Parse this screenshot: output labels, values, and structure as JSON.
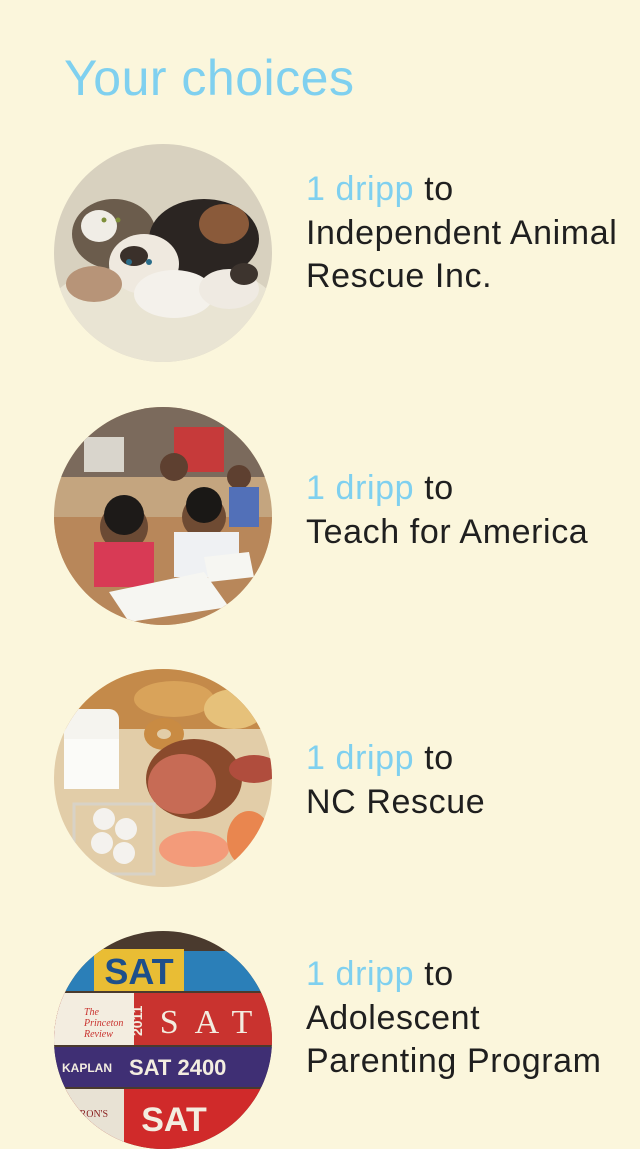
{
  "header": {
    "title": "Your choices"
  },
  "choices": [
    {
      "amount": "1 dripp",
      "connector": "to",
      "name": "Independent Animal Rescue Inc.",
      "image_icon": "kittens-photo"
    },
    {
      "amount": "1 dripp",
      "connector": "to",
      "name": "Teach for America",
      "image_icon": "children-classroom-photo"
    },
    {
      "amount": "1 dripp",
      "connector": "to",
      "name": "NC Rescue",
      "image_icon": "food-groceries-photo"
    },
    {
      "amount": "1 dripp",
      "connector": "to",
      "name": "Adolescent Parenting Program",
      "image_icon": "sat-books-photo"
    }
  ],
  "book_labels": {
    "top": "SAT",
    "princeton_line1": "The",
    "princeton_line2": "Princeton",
    "princeton_line3": "Review",
    "year": "2011",
    "side": "SAT",
    "kaplan": "KAPLAN",
    "sat2400": "SAT 2400",
    "barrons": "BARRON'S",
    "bottom": "SAT"
  },
  "colors": {
    "background": "#fbf6dc",
    "accent": "#7fd0ef",
    "text": "#1f1f1f"
  }
}
